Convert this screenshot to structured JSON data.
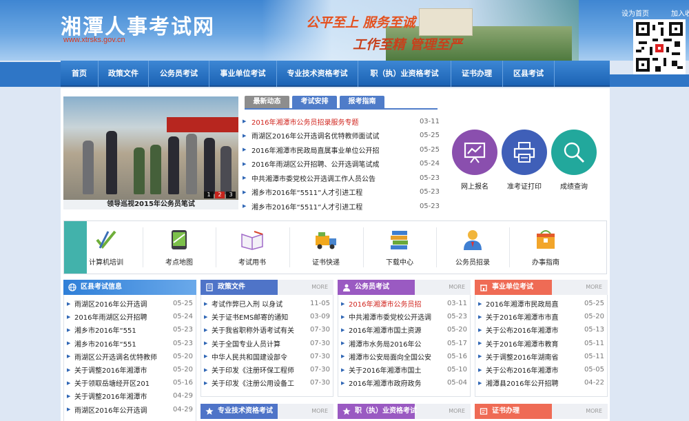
{
  "header": {
    "site_title": "湘潭人事考试网",
    "site_url": "www.xtrsks.gov.cn",
    "slogan_line1": "公平至上  服务至诚",
    "slogan_line2": "工作至精  管理至严",
    "set_home": "设为首页",
    "add_fav": "加入收藏"
  },
  "nav": [
    "首页",
    "政策文件",
    "公务员考试",
    "事业单位考试",
    "专业技术资格考试",
    "职（执）业资格考试",
    "证书办理",
    "区县考试"
  ],
  "photo": {
    "caption": "领导巡视2015年公务员笔试",
    "pages": [
      "1",
      "2",
      "3"
    ]
  },
  "news_tabs": [
    "最新动态",
    "考试安排",
    "报考指南"
  ],
  "news": [
    {
      "title": "2016年湘潭市公务员招录服务专题",
      "date": "03-11",
      "red": true
    },
    {
      "title": "雨湖区2016年公开选调名优特教师面试试",
      "date": "05-25"
    },
    {
      "title": "2016年湘潭市民政局直属事业单位公开招",
      "date": "05-25"
    },
    {
      "title": "2016年雨湖区公开招聘、公开选调笔试成",
      "date": "05-24"
    },
    {
      "title": "中共湘潭市委党校公开选调工作人员公告",
      "date": "05-23"
    },
    {
      "title": "湘乡市2016年“5511”人才引进工程",
      "date": "05-23"
    },
    {
      "title": "湘乡市2016年“5511”人才引进工程",
      "date": "05-23"
    }
  ],
  "services": [
    {
      "label": "网上报名",
      "color": "#8a4fae",
      "icon": "chart-screen-icon"
    },
    {
      "label": "准考证打印",
      "color": "#3f5fb8",
      "icon": "printer-icon"
    },
    {
      "label": "成绩查询",
      "color": "#22a89c",
      "icon": "search-icon"
    }
  ],
  "quick_links": [
    {
      "label": "计算机培训",
      "icon": "pen-check-icon"
    },
    {
      "label": "考点地图",
      "icon": "map-tablet-icon"
    },
    {
      "label": "考试用书",
      "icon": "book-icon"
    },
    {
      "label": "证书快递",
      "icon": "truck-icon"
    },
    {
      "label": "下载中心",
      "icon": "books-stack-icon"
    },
    {
      "label": "公务员招录",
      "icon": "person-icon"
    },
    {
      "label": "办事指南",
      "icon": "guide-box-icon"
    }
  ],
  "panels": [
    {
      "title": "区县考试信息",
      "more": "",
      "color": "#2f7fd8",
      "rows": [
        {
          "title": "雨湖区2016年公开选调",
          "date": "05-25"
        },
        {
          "title": "2016年雨湖区公开招聘",
          "date": "05-24"
        },
        {
          "title": "湘乡市2016年“551",
          "date": "05-23"
        },
        {
          "title": "湘乡市2016年“551",
          "date": "05-23"
        },
        {
          "title": "雨湖区公开选调名优特教师",
          "date": "05-20"
        },
        {
          "title": "关于调整2016年湘潭市",
          "date": "05-20"
        },
        {
          "title": "关于领取岳塘经开区201",
          "date": "05-16"
        },
        {
          "title": "关于调整2016年湘潭市",
          "date": "04-29"
        },
        {
          "title": "雨湖区2016年公开选调",
          "date": "04-29"
        }
      ]
    },
    {
      "title": "政策文件",
      "more": "MORE",
      "color": "#4f74c8",
      "rows": [
        {
          "title": "考试作弊已入刑 以身试",
          "date": "11-05"
        },
        {
          "title": "关于证书EMS邮寄的通知",
          "date": "03-09"
        },
        {
          "title": "关于我省职称外语考试有关",
          "date": "07-30"
        },
        {
          "title": "关于全国专业人员计算",
          "date": "07-30"
        },
        {
          "title": "中华人民共和国建设部令",
          "date": "07-30"
        },
        {
          "title": "关于印发《注册环保工程师",
          "date": "07-30"
        },
        {
          "title": "关于印发《注册公用设备工",
          "date": "07-30"
        }
      ]
    },
    {
      "title": "公务员考试",
      "more": "MORE",
      "color": "#9a5ac2",
      "rows": [
        {
          "title": "2016年湘潭市公务员招",
          "date": "03-11",
          "red": true
        },
        {
          "title": "中共湘潭市委党校公开选调",
          "date": "05-23"
        },
        {
          "title": "2016年湘潭市国土资源",
          "date": "05-20"
        },
        {
          "title": "湘潭市水务局2016年公",
          "date": "05-17"
        },
        {
          "title": "湘潭市公安局面向全国公安",
          "date": "05-16"
        },
        {
          "title": "关于2016年湘潭市国土",
          "date": "05-10"
        },
        {
          "title": "2016年湘潭市政府政务",
          "date": "05-04"
        }
      ]
    },
    {
      "title": "事业单位考试",
      "more": "MORE",
      "color": "#ef6b55",
      "rows": [
        {
          "title": "2016年湘潭市民政局直",
          "date": "05-25"
        },
        {
          "title": "关于2016年湘潭市市直",
          "date": "05-20"
        },
        {
          "title": "关于公布2016年湘潭市",
          "date": "05-13"
        },
        {
          "title": "关于2016年湘潭市教育",
          "date": "05-11"
        },
        {
          "title": "关于调整2016年湖南省",
          "date": "05-11"
        },
        {
          "title": "关于公布2016年湘潭市",
          "date": "05-05"
        },
        {
          "title": "湘潭县2016年公开招聘",
          "date": "04-22"
        }
      ]
    }
  ],
  "bottom_panels": [
    {
      "title": "专业技术资格考试",
      "more": "MORE",
      "color": "#4f74c8"
    },
    {
      "title": "职（执）业资格考试",
      "more": "MORE",
      "color": "#9a5ac2"
    },
    {
      "title": "证书办理",
      "more": "MORE",
      "color": "#ef6b55"
    }
  ]
}
